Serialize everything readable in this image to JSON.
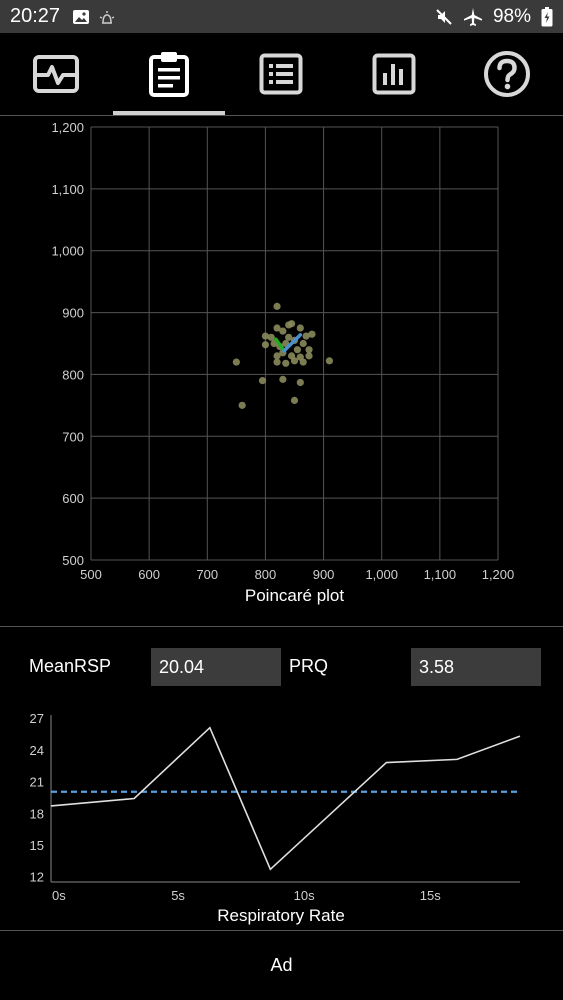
{
  "status_bar": {
    "time": "20:27",
    "battery": "98%",
    "left_icons": [
      "image-icon",
      "alarm-icon"
    ],
    "right_icons": [
      "mute-icon",
      "airplane-icon",
      "battery-icon"
    ]
  },
  "tabs": [
    {
      "icon": "heartbeat-monitor-icon",
      "active": false
    },
    {
      "icon": "clipboard-icon",
      "active": true
    },
    {
      "icon": "list-icon",
      "active": false
    },
    {
      "icon": "bar-chart-icon",
      "active": false
    },
    {
      "icon": "help-icon",
      "active": false
    }
  ],
  "stats": {
    "mean_rsp_label": "MeanRSP",
    "mean_rsp_value": "20.04",
    "prq_label": "PRQ",
    "prq_value": "3.58"
  },
  "ad": {
    "label": "Ad"
  },
  "colors": {
    "background": "#000000",
    "grid": "#555555",
    "points": "#8a8a5c",
    "sd1_line": "#22aa22",
    "sd2_line": "#4a8fd0",
    "mean_line": "#5aa0e0",
    "resp_line": "#e0e0e0"
  },
  "chart_data": [
    {
      "type": "scatter",
      "title": "",
      "xlabel": "Poincaré plot",
      "ylabel": "",
      "xlim": [
        500,
        1200
      ],
      "ylim": [
        500,
        1200
      ],
      "x_ticks": [
        "500",
        "600",
        "700",
        "800",
        "900",
        "1,000",
        "1,100",
        "1,200"
      ],
      "y_ticks": [
        "500",
        "600",
        "700",
        "800",
        "900",
        "1,000",
        "1,100",
        "1,200"
      ],
      "grid": true,
      "points": [
        [
          820,
          910
        ],
        [
          810,
          860
        ],
        [
          800,
          862
        ],
        [
          820,
          875
        ],
        [
          830,
          870
        ],
        [
          840,
          880
        ],
        [
          845,
          882
        ],
        [
          860,
          875
        ],
        [
          870,
          862
        ],
        [
          880,
          865
        ],
        [
          800,
          848
        ],
        [
          815,
          850
        ],
        [
          825,
          845
        ],
        [
          835,
          850
        ],
        [
          850,
          855
        ],
        [
          865,
          850
        ],
        [
          875,
          840
        ],
        [
          820,
          830
        ],
        [
          830,
          835
        ],
        [
          845,
          830
        ],
        [
          860,
          828
        ],
        [
          875,
          830
        ],
        [
          820,
          820
        ],
        [
          835,
          818
        ],
        [
          850,
          822
        ],
        [
          865,
          820
        ],
        [
          910,
          822
        ],
        [
          750,
          820
        ],
        [
          795,
          790
        ],
        [
          830,
          792
        ],
        [
          860,
          787
        ],
        [
          850,
          758
        ],
        [
          760,
          750
        ],
        [
          840,
          860
        ],
        [
          855,
          840
        ]
      ],
      "lines": [
        {
          "name": "SD1",
          "color": "#22aa22",
          "from": [
            818,
            857
          ],
          "to": [
            832,
            838
          ]
        },
        {
          "name": "SD2",
          "color": "#4a8fd0",
          "from": [
            832,
            838
          ],
          "to": [
            860,
            864
          ]
        }
      ]
    },
    {
      "type": "line",
      "title": "",
      "xlabel": "Respiratory Rate",
      "ylabel": "",
      "xlim": [
        0,
        18.6
      ],
      "ylim": [
        11.5,
        27.3
      ],
      "x_ticks": [
        {
          "value": 0,
          "label": "0s"
        },
        {
          "value": 5,
          "label": "5s"
        },
        {
          "value": 10,
          "label": "10s"
        },
        {
          "value": 15,
          "label": "15s"
        }
      ],
      "y_ticks": [
        "27",
        "24",
        "21",
        "18",
        "15",
        "12"
      ],
      "grid": false,
      "series": [
        {
          "x": [
            0,
            3.3,
            6.3,
            8.7,
            13.3,
            16.1,
            18.6
          ],
          "y": [
            18.7,
            19.4,
            26.1,
            12.7,
            22.8,
            23.1,
            25.3
          ]
        }
      ],
      "mean_line": 20.04
    }
  ]
}
